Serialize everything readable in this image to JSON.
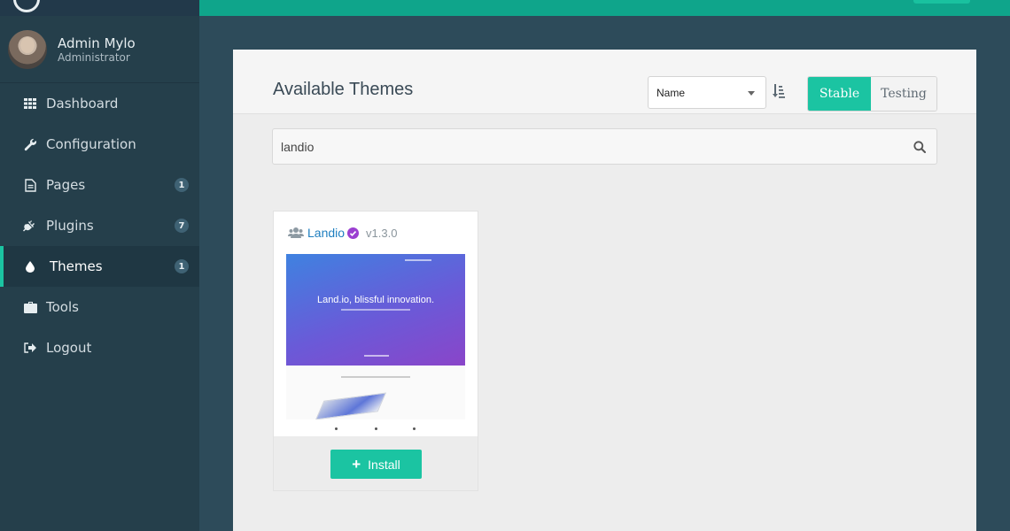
{
  "user": {
    "name": "Admin Mylo",
    "role": "Administrator"
  },
  "nav": [
    {
      "label": "Dashboard",
      "icon": "grid-icon",
      "badge": null
    },
    {
      "label": "Configuration",
      "icon": "wrench-icon",
      "badge": null
    },
    {
      "label": "Pages",
      "icon": "document-icon",
      "badge": "1"
    },
    {
      "label": "Plugins",
      "icon": "plug-icon",
      "badge": "7"
    },
    {
      "label": "Themes",
      "icon": "droplet-icon",
      "badge": "1",
      "active": true
    },
    {
      "label": "Tools",
      "icon": "briefcase-icon",
      "badge": null
    },
    {
      "label": "Logout",
      "icon": "sign-out-icon",
      "badge": null
    }
  ],
  "panel": {
    "title": "Available Themes",
    "sort": {
      "selected": "Name"
    },
    "toggle": {
      "stable": "Stable",
      "testing": "Testing",
      "active": "Stable"
    },
    "search": {
      "value": "landio"
    }
  },
  "card": {
    "name": "Landio",
    "version": "v1.3.0",
    "preview_headline": "Land.io, blissful innovation.",
    "install_label": "Install"
  },
  "colors": {
    "accent": "#1bc4a2",
    "sidebar": "#253f4b",
    "topbar": "#0fa58b",
    "verified": "#9b3fd1",
    "link": "#1f7fc0"
  }
}
